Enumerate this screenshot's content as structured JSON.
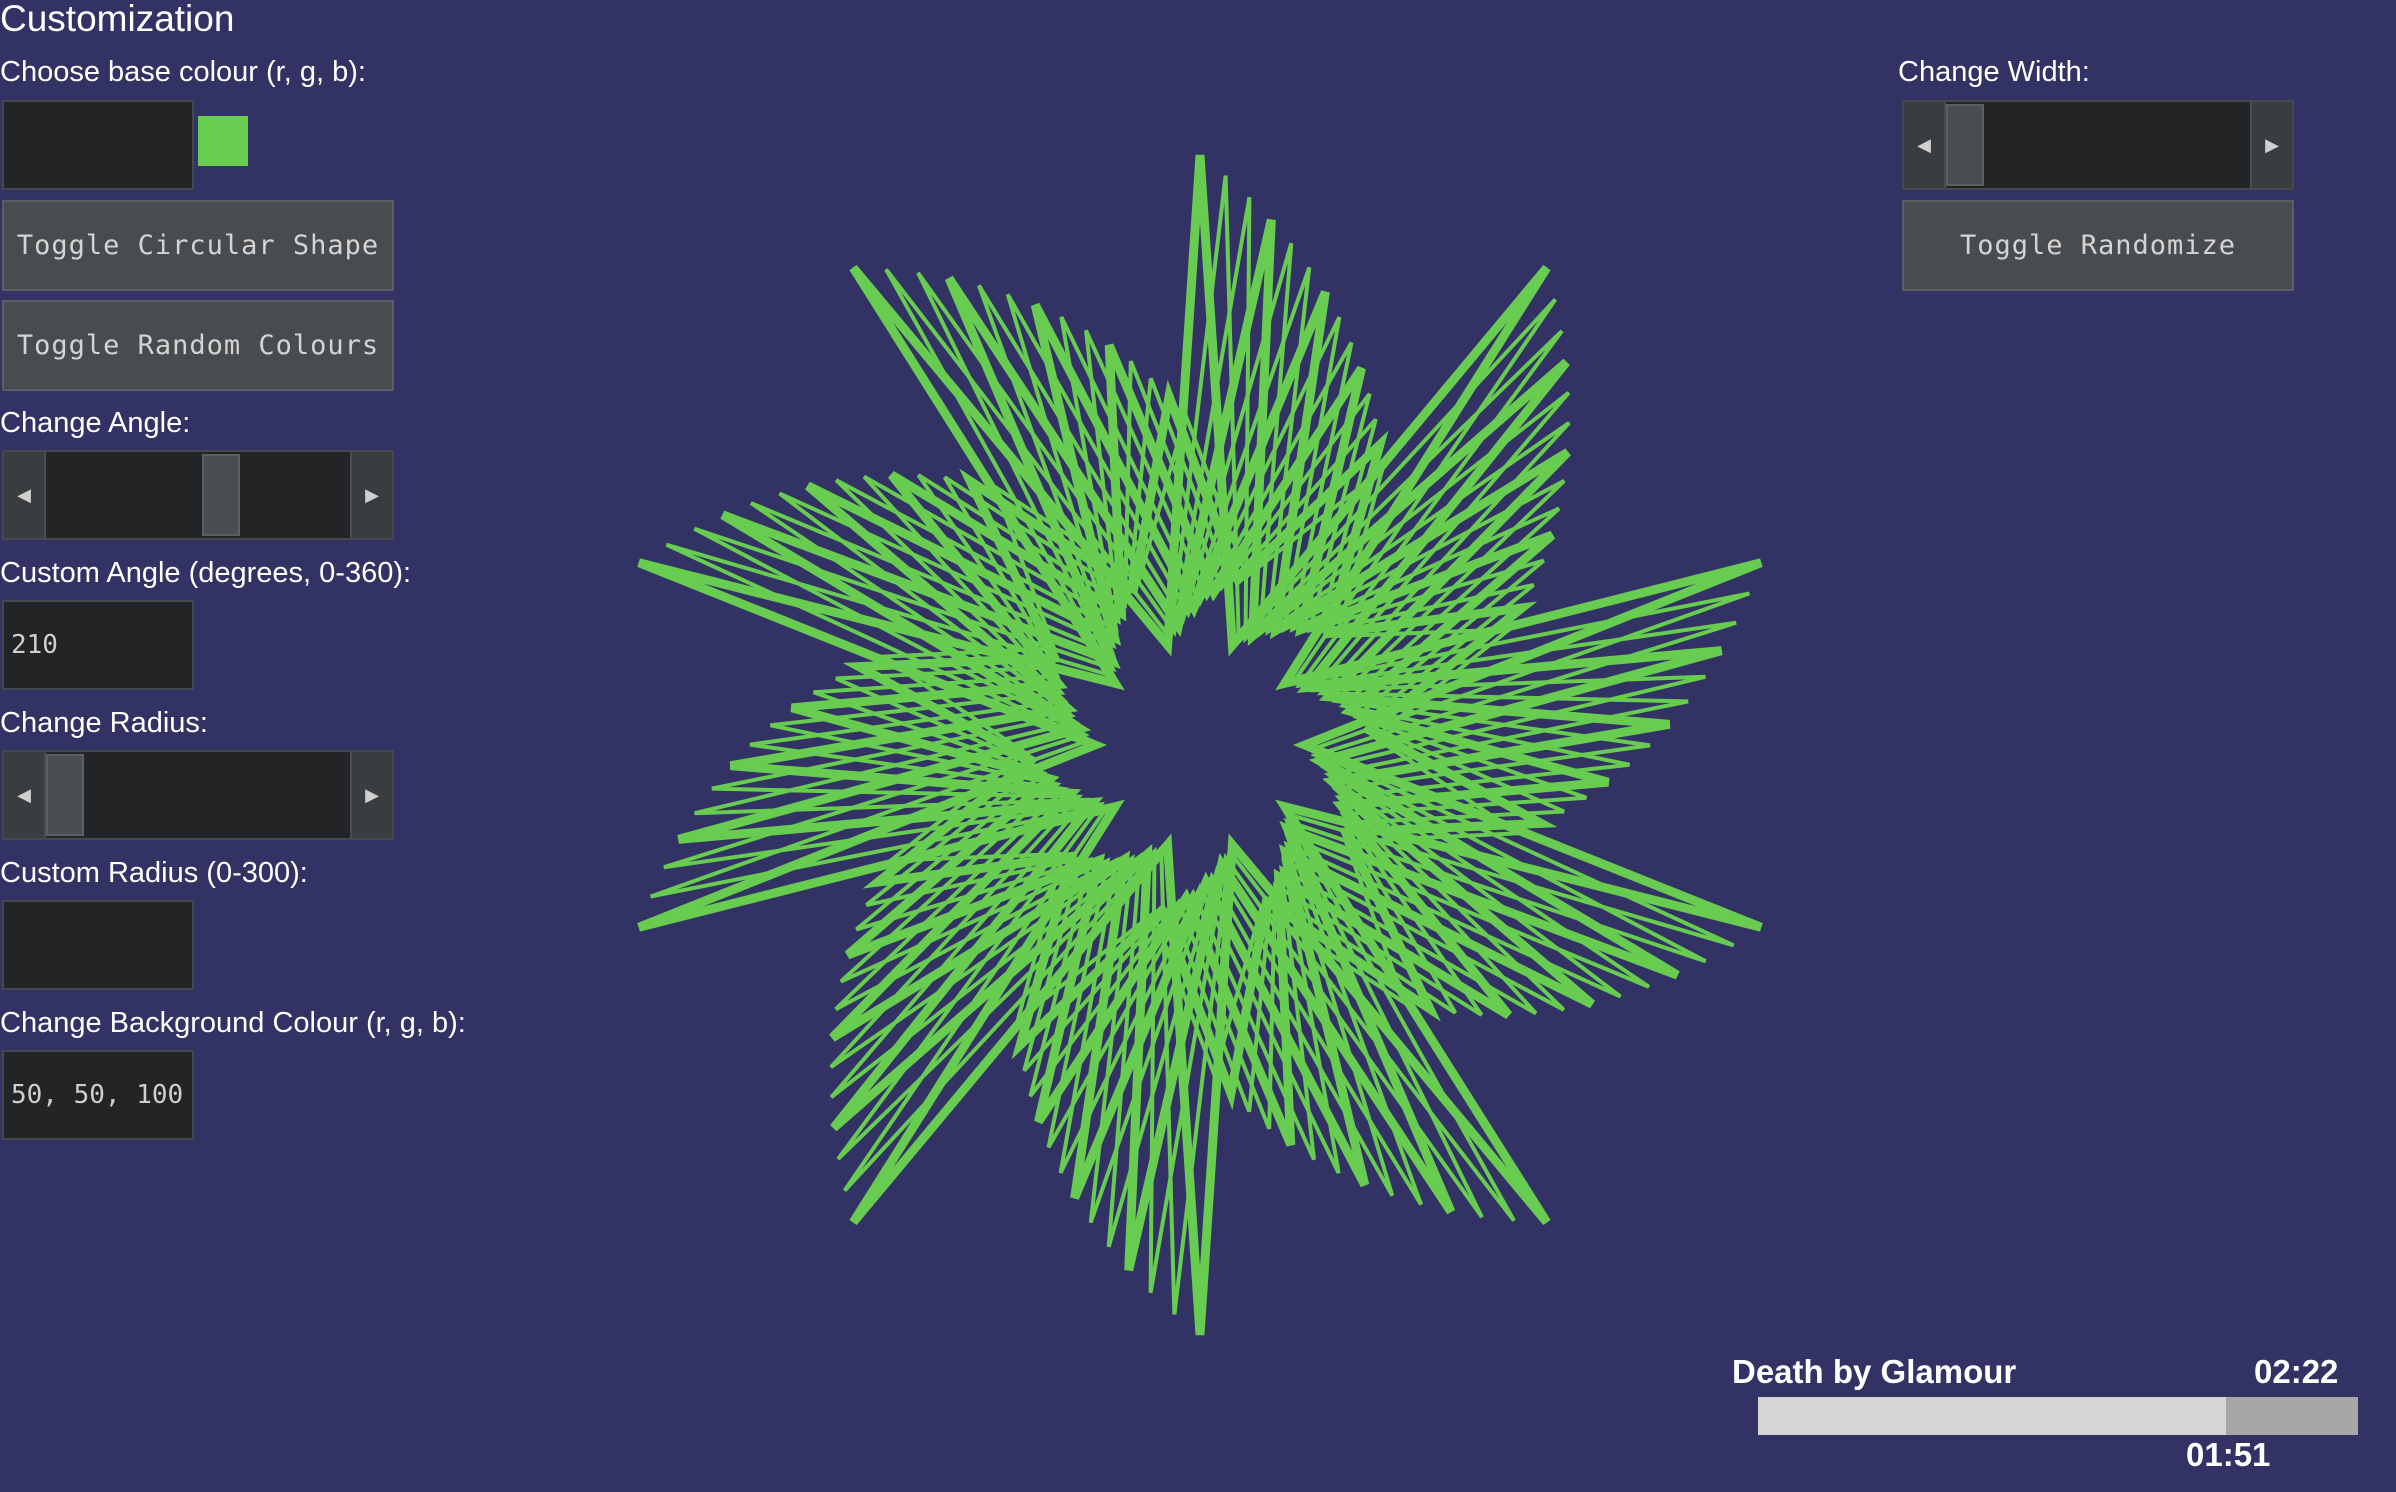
{
  "panel": {
    "title": "Customization",
    "base_colour_label": "Choose base colour (r, g, b):",
    "base_colour_value": "",
    "swatch_color": "#67cc50",
    "toggle_circular_label": "Toggle Circular Shape",
    "toggle_random_colours_label": "Toggle Random Colours",
    "angle_label": "Change Angle:",
    "angle_slider_fraction": 0.58,
    "custom_angle_label": "Custom Angle (degrees, 0-360):",
    "custom_angle_value": "210",
    "radius_label": "Change Radius:",
    "radius_slider_fraction": 0.0,
    "custom_radius_label": "Custom Radius (0-300):",
    "custom_radius_value": "",
    "background_label": "Change Background Colour (r, g, b):",
    "background_value": "50, 50, 100",
    "width_label": "Change Width:",
    "width_slider_fraction": 0.0,
    "toggle_randomize_label": "Toggle Randomize",
    "left_arrow_icon": "◀",
    "right_arrow_icon": "▶"
  },
  "canvas": {
    "background_color": "#323264",
    "shape_color": "#67cc50",
    "shape": "star-polygon",
    "points": 10
  },
  "player": {
    "song_title": "Death by Glamour",
    "total_time": "02:22",
    "elapsed_time": "01:51",
    "progress_fraction": 0.78
  }
}
